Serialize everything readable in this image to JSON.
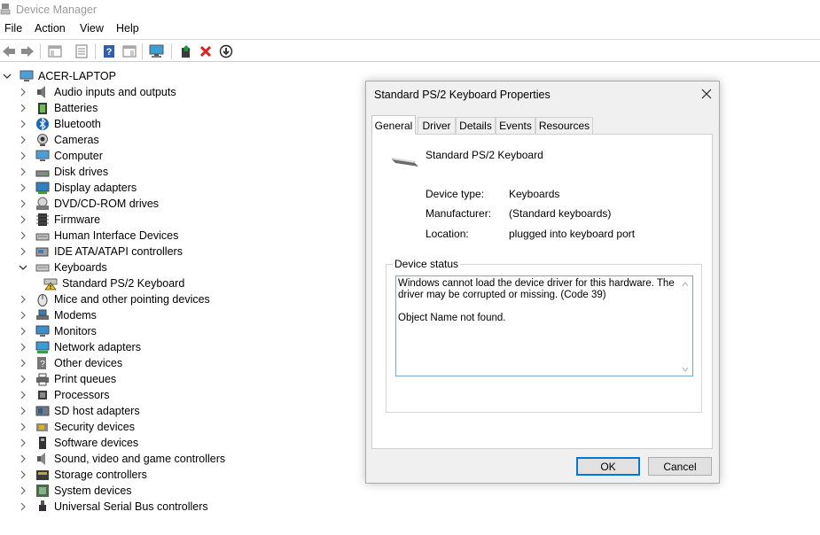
{
  "window": {
    "title": "Device Manager"
  },
  "menu": [
    "File",
    "Action",
    "View",
    "Help"
  ],
  "toolbar": {
    "buttons": [
      "back-arrow-icon",
      "forward-arrow-icon",
      "show-hide-console-tree-icon",
      "properties-sheet-icon",
      "help-icon",
      "action-pane-icon",
      "display-monitor-icon",
      "update-driver-icon",
      "uninstall-device-icon",
      "download-circle-icon"
    ]
  },
  "tree": {
    "root": "ACER-LAPTOP",
    "items": [
      {
        "label": "Audio inputs and outputs",
        "icon": "speaker-icon"
      },
      {
        "label": "Batteries",
        "icon": "battery-icon"
      },
      {
        "label": "Bluetooth",
        "icon": "bluetooth-icon"
      },
      {
        "label": "Cameras",
        "icon": "camera-icon"
      },
      {
        "label": "Computer",
        "icon": "computer-icon"
      },
      {
        "label": "Disk drives",
        "icon": "disk-drive-icon"
      },
      {
        "label": "Display adapters",
        "icon": "display-adapter-icon"
      },
      {
        "label": "DVD/CD-ROM drives",
        "icon": "dvd-drive-icon"
      },
      {
        "label": "Firmware",
        "icon": "firmware-icon"
      },
      {
        "label": "Human Interface Devices",
        "icon": "hid-icon"
      },
      {
        "label": "IDE ATA/ATAPI controllers",
        "icon": "ide-controller-icon"
      },
      {
        "label": "Keyboards",
        "icon": "keyboard-icon",
        "expanded": true
      },
      {
        "label": "Standard PS/2 Keyboard",
        "icon": "warning-keyboard-icon",
        "child": true
      },
      {
        "label": "Mice and other pointing devices",
        "icon": "mouse-icon"
      },
      {
        "label": "Modems",
        "icon": "modem-icon"
      },
      {
        "label": "Monitors",
        "icon": "monitor-icon"
      },
      {
        "label": "Network adapters",
        "icon": "network-adapter-icon"
      },
      {
        "label": "Other devices",
        "icon": "other-devices-icon"
      },
      {
        "label": "Print queues",
        "icon": "printer-icon"
      },
      {
        "label": "Processors",
        "icon": "processor-icon"
      },
      {
        "label": "SD host adapters",
        "icon": "sd-adapter-icon"
      },
      {
        "label": "Security devices",
        "icon": "security-device-icon"
      },
      {
        "label": "Software devices",
        "icon": "software-device-icon"
      },
      {
        "label": "Sound, video and game controllers",
        "icon": "sound-controller-icon"
      },
      {
        "label": "Storage controllers",
        "icon": "storage-controller-icon"
      },
      {
        "label": "System devices",
        "icon": "system-device-icon"
      },
      {
        "label": "Universal Serial Bus controllers",
        "icon": "usb-icon"
      }
    ]
  },
  "dialog": {
    "title": "Standard PS/2 Keyboard Properties",
    "tabs": [
      "General",
      "Driver",
      "Details",
      "Events",
      "Resources"
    ],
    "active_tab": "General",
    "device_name": "Standard PS/2 Keyboard",
    "properties": [
      {
        "label": "Device type:",
        "value": "Keyboards"
      },
      {
        "label": "Manufacturer:",
        "value": "(Standard keyboards)"
      },
      {
        "label": "Location:",
        "value": "plugged into keyboard port"
      }
    ],
    "status_group_label": "Device status",
    "status_text": "Windows cannot load the device driver for this hardware. The driver may be corrupted or missing. (Code 39)\n\nObject Name not found.",
    "ok_label": "OK",
    "cancel_label": "Cancel"
  }
}
